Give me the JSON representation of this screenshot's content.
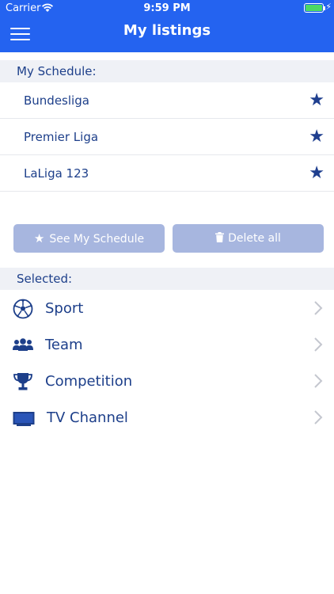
{
  "status_bar": {
    "carrier": "Carrier",
    "time": "9:59 PM"
  },
  "nav": {
    "title": "My listings"
  },
  "schedule": {
    "header": "My Schedule:",
    "items": [
      {
        "label": "Bundesliga"
      },
      {
        "label": "Premier Liga"
      },
      {
        "label": "LaLiga 123"
      }
    ]
  },
  "buttons": {
    "see_schedule": "See My Schedule",
    "delete_all": "Delete all"
  },
  "selected": {
    "header": "Selected:",
    "items": [
      {
        "label": "Sport",
        "icon": "soccer-ball-icon"
      },
      {
        "label": "Team",
        "icon": "team-icon"
      },
      {
        "label": "Competition",
        "icon": "trophy-icon"
      },
      {
        "label": "TV Channel",
        "icon": "tv-icon"
      }
    ]
  },
  "colors": {
    "accent": "#2463f0",
    "text": "#1d3f8a",
    "button_disabled": "#a7b6df"
  }
}
